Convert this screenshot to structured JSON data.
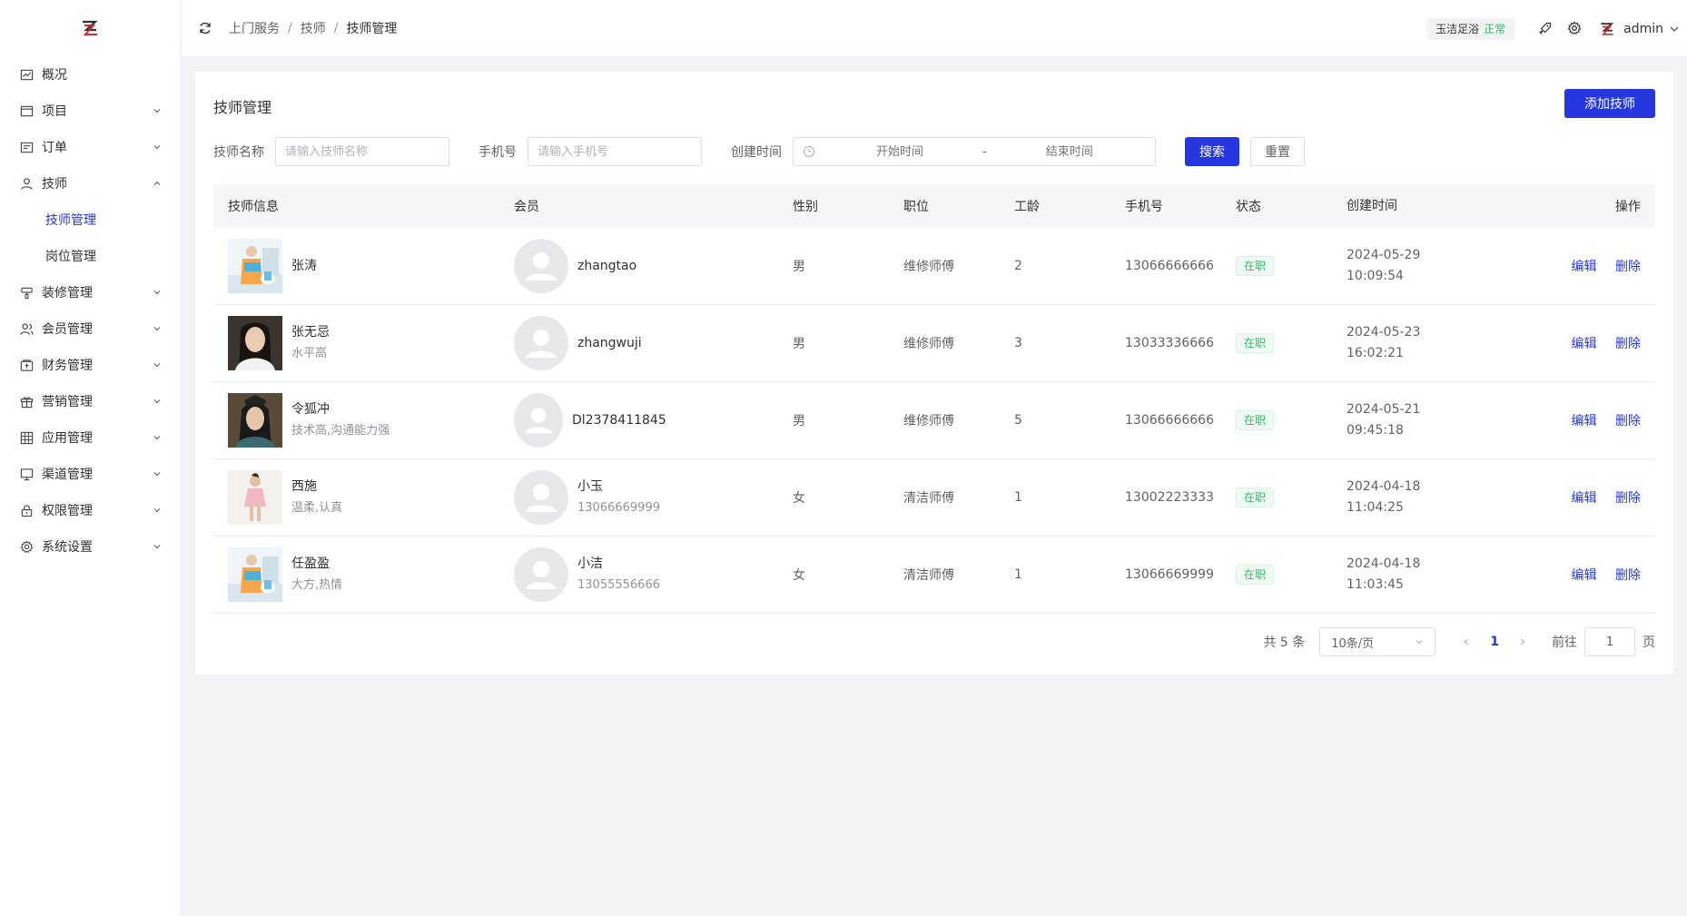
{
  "colors": {
    "primary": "#2637e0",
    "success": "#3bb46a",
    "background": "#f2f3f5"
  },
  "sidebar": {
    "items": [
      {
        "label": "概况",
        "icon": "chart-icon"
      },
      {
        "label": "项目",
        "icon": "window-icon"
      },
      {
        "label": "订单",
        "icon": "order-icon"
      },
      {
        "label": "技师",
        "icon": "user-icon",
        "expanded": true,
        "children": [
          {
            "label": "技师管理",
            "active": true
          },
          {
            "label": "岗位管理"
          }
        ]
      },
      {
        "label": "装修管理",
        "icon": "brush-icon"
      },
      {
        "label": "会员管理",
        "icon": "users-icon"
      },
      {
        "label": "财务管理",
        "icon": "wallet-icon"
      },
      {
        "label": "营销管理",
        "icon": "gift-icon"
      },
      {
        "label": "应用管理",
        "icon": "grid-icon"
      },
      {
        "label": "渠道管理",
        "icon": "monitor-icon"
      },
      {
        "label": "权限管理",
        "icon": "lock-icon"
      },
      {
        "label": "系统设置",
        "icon": "gear-icon"
      }
    ]
  },
  "header": {
    "breadcrumb": [
      "上门服务",
      "技师",
      "技师管理"
    ],
    "shop_name": "玉洁足浴",
    "shop_status": "正常",
    "user": "admin"
  },
  "page": {
    "title": "技师管理",
    "add_button": "添加技师"
  },
  "filters": {
    "name_label": "技师名称",
    "name_placeholder": "请输入技师名称",
    "phone_label": "手机号",
    "phone_placeholder": "请输入手机号",
    "time_label": "创建时间",
    "start_placeholder": "开始时间",
    "range_sep": "-",
    "end_placeholder": "结束时间",
    "search": "搜索",
    "reset": "重置"
  },
  "table": {
    "columns": [
      "技师信息",
      "会员",
      "性别",
      "职位",
      "工龄",
      "手机号",
      "状态",
      "创建时间",
      "操作"
    ],
    "rows": [
      {
        "name": "张涛",
        "desc": "",
        "member_name": "zhangtao",
        "member_phone": "",
        "gender": "男",
        "position": "维修师傅",
        "years": "2",
        "phone": "13066666666",
        "status": "在职",
        "date": "2024-05-29",
        "time": "10:09:54"
      },
      {
        "name": "张无忌",
        "desc": "水平高",
        "member_name": "zhangwuji",
        "member_phone": "",
        "gender": "男",
        "position": "维修师傅",
        "years": "3",
        "phone": "13033336666",
        "status": "在职",
        "date": "2024-05-23",
        "time": "16:02:21"
      },
      {
        "name": "令狐冲",
        "desc": "技术高,沟通能力强",
        "member_name": "Dl2378411845",
        "member_phone": "",
        "gender": "男",
        "position": "维修师傅",
        "years": "5",
        "phone": "13066666666",
        "status": "在职",
        "date": "2024-05-21",
        "time": "09:45:18"
      },
      {
        "name": "西施",
        "desc": "温柔,认真",
        "member_name": "小玉",
        "member_phone": "13066669999",
        "gender": "女",
        "position": "清洁师傅",
        "years": "1",
        "phone": "13002223333",
        "status": "在职",
        "date": "2024-04-18",
        "time": "11:04:25"
      },
      {
        "name": "任盈盈",
        "desc": "大方,热情",
        "member_name": "小洁",
        "member_phone": "13055556666",
        "gender": "女",
        "position": "清洁师傅",
        "years": "1",
        "phone": "13066669999",
        "status": "在职",
        "date": "2024-04-18",
        "time": "11:03:45"
      }
    ],
    "edit_label": "编辑",
    "delete_label": "删除"
  },
  "pagination": {
    "total_text": "共 5 条",
    "page_size": "10条/页",
    "current_page": "1",
    "goto_label": "前往",
    "goto_value": "1",
    "page_suffix": "页"
  }
}
